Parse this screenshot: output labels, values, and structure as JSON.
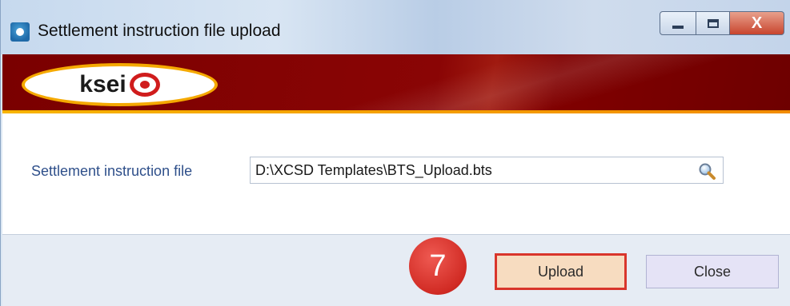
{
  "window": {
    "title": "Settlement instruction file upload",
    "controls": {
      "minimize_icon": "minimize-icon",
      "maximize_icon": "maximize-icon",
      "close_glyph": "X"
    }
  },
  "banner": {
    "logo_text": "ksei",
    "colors": {
      "banner": "#7a0000",
      "accent": "#f5a900",
      "logo_mark": "#d01c1c"
    }
  },
  "form": {
    "file_label": "Settlement instruction file",
    "file_value": "D:\\XCSD Templates\\BTS_Upload.bts",
    "browse_icon": "magnifier-icon"
  },
  "footer": {
    "step_badge": "7",
    "upload_label": "Upload",
    "close_label": "Close",
    "colors": {
      "highlight": "#d9352b",
      "badge": "#d12b24"
    }
  }
}
